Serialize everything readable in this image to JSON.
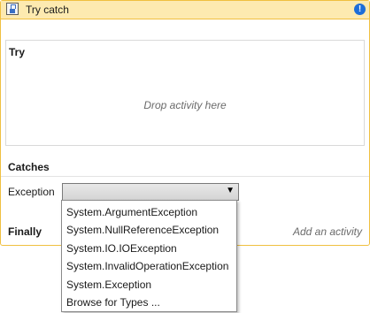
{
  "activity": {
    "title": "Try catch",
    "info_glyph": "!",
    "try_label": "Try",
    "drop_hint": "Drop activity here",
    "catches_label": "Catches",
    "exception_label": "Exception",
    "exception_value": "",
    "finally_label": "Finally",
    "finally_hint": "Add an activity"
  },
  "dropdown": {
    "items": [
      {
        "label": "System.ArgumentException"
      },
      {
        "label": "System.NullReferenceException"
      },
      {
        "label": "System.IO.IOException"
      },
      {
        "label": "System.InvalidOperationException"
      },
      {
        "label": "System.Exception"
      },
      {
        "label": "Browse for Types ..."
      }
    ]
  },
  "icons": {
    "header": "try-catch-activity-icon",
    "info": "info-icon",
    "caret": "chevron-down-icon"
  },
  "colors": {
    "header_bg": "#fdeab0",
    "border": "#f0c040",
    "info": "#1d6ed8"
  }
}
